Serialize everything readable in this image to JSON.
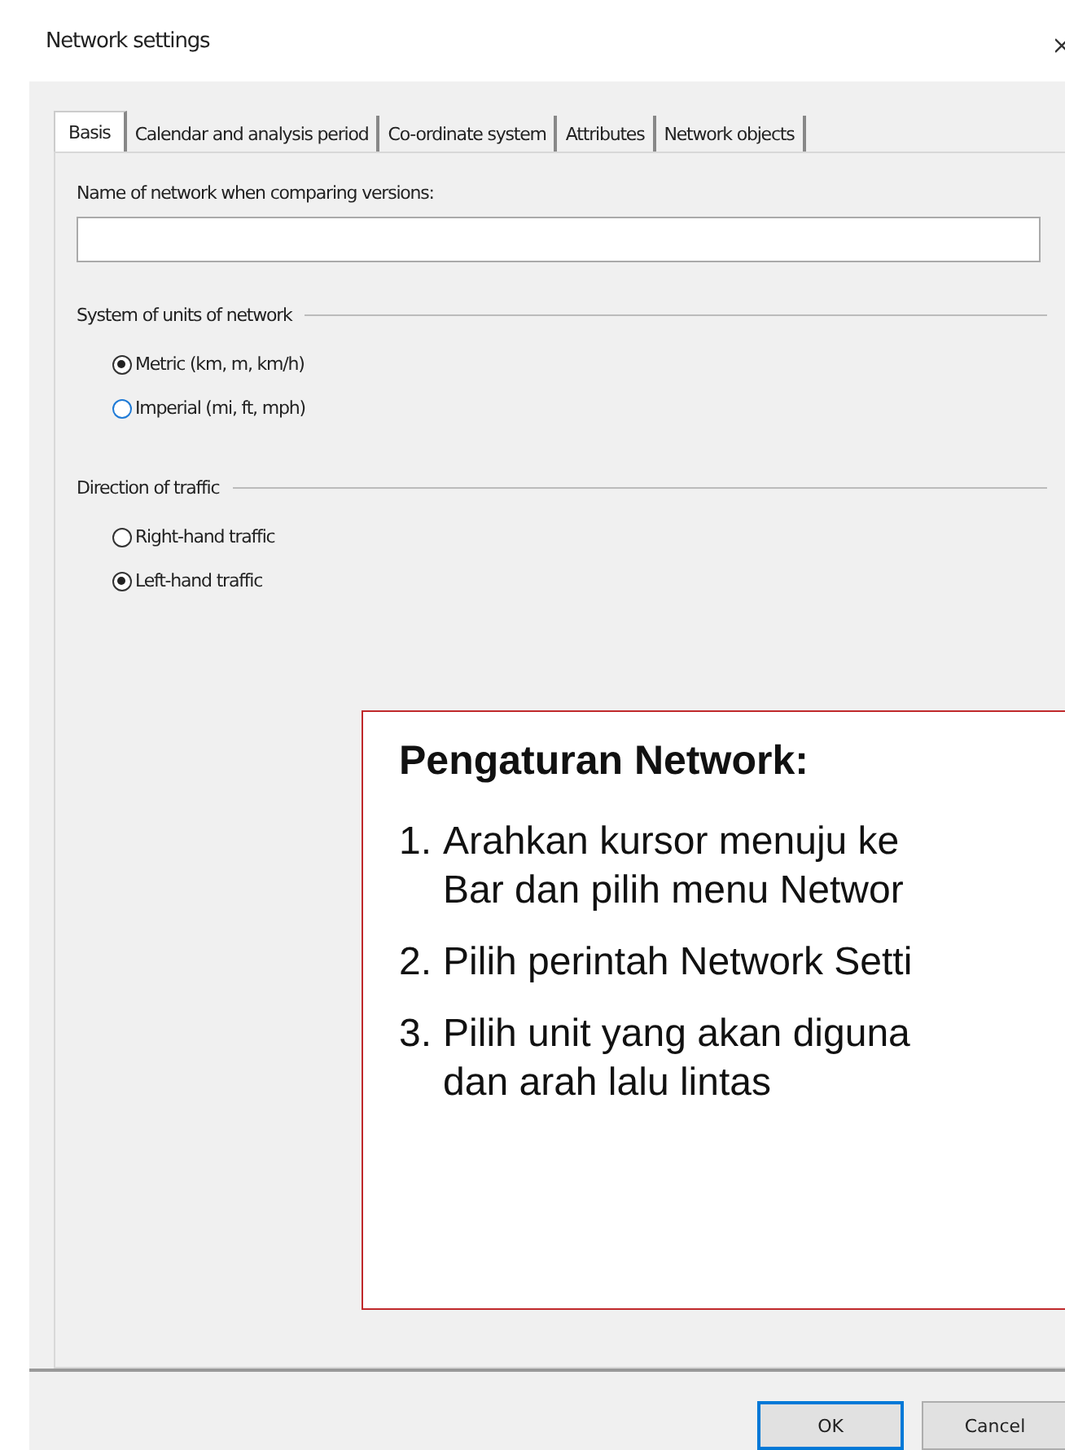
{
  "window": {
    "title": "Network settings"
  },
  "tabs": [
    {
      "label": "Basis",
      "selected": true
    },
    {
      "label": "Calendar and analysis period",
      "selected": false
    },
    {
      "label": "Co-ordinate system",
      "selected": false
    },
    {
      "label": "Attributes",
      "selected": false
    },
    {
      "label": "Network objects",
      "selected": false
    }
  ],
  "name_field": {
    "label": "Name of network when comparing versions:"
  },
  "groups": [
    {
      "title": "System of units of network",
      "options": [
        {
          "label": "Metric (km, m, km/h)",
          "selected": true
        },
        {
          "label": "Imperial (mi, ft, mph)",
          "selected": false
        }
      ]
    },
    {
      "title": "Direction of traffic",
      "options": [
        {
          "label": "Right-hand traffic",
          "selected": false
        },
        {
          "label": "Left-hand traffic",
          "selected": true
        }
      ]
    }
  ],
  "callout": {
    "title": "Pengaturan Network:",
    "steps": [
      {
        "number": "1.",
        "lines": [
          "Arahkan kursor menuju ke",
          "Bar dan pilih menu Networ"
        ]
      },
      {
        "number": "2.",
        "lines": [
          "Pilih perintah Network Setti"
        ]
      },
      {
        "number": "3.",
        "lines": [
          "Pilih unit yang akan diguna",
          "dan arah lalu lintas"
        ]
      }
    ]
  },
  "buttons": [
    {
      "label": "OK",
      "kind": "default"
    },
    {
      "label": "Cancel",
      "kind": "normal"
    }
  ]
}
